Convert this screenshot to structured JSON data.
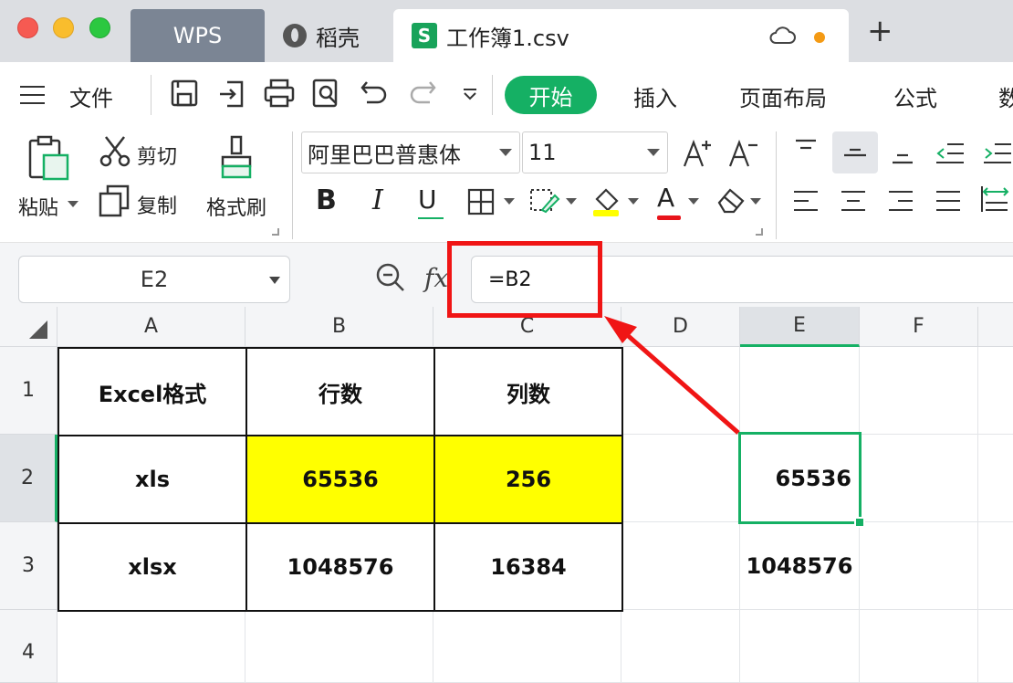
{
  "tabs": {
    "wps": "WPS",
    "daoke": "稻壳",
    "doc": "工作簿1.csv",
    "doc_icon_letter": "S"
  },
  "menu": {
    "file": "文件",
    "start": "开始",
    "insert": "插入",
    "page_layout": "页面布局",
    "formula": "公式",
    "data_partial": "数"
  },
  "ribbon": {
    "paste": "粘贴",
    "cut": "剪切",
    "copy": "复制",
    "format_painter": "格式刷",
    "font_name": "阿里巴巴普惠体",
    "font_size": "11",
    "bold": "B",
    "italic": "I",
    "underline": "U",
    "font_color_letter": "A"
  },
  "formula_bar": {
    "name_box": "E2",
    "fx": "fx",
    "formula": "=B2"
  },
  "columns": [
    "A",
    "B",
    "C",
    "D",
    "E",
    "F"
  ],
  "rows": [
    "1",
    "2",
    "3",
    "4"
  ],
  "cells": {
    "A1": "Excel格式",
    "B1": "行数",
    "C1": "列数",
    "A2": "xls",
    "B2": "65536",
    "C2": "256",
    "A3": "xlsx",
    "B3": "1048576",
    "C3": "16384",
    "E2": "65536",
    "E3": "1048576"
  },
  "colors": {
    "accent": "#15b064",
    "highlight": "#ffff00",
    "annotation": "#f01515",
    "modified_dot": "#f49a14"
  }
}
